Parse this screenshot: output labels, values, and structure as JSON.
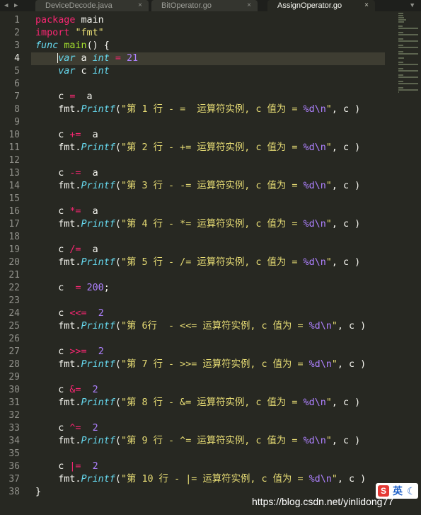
{
  "tabs": [
    {
      "label": "DeviceDecode.java",
      "active": false,
      "close": "×"
    },
    {
      "label": "BitOperator.go",
      "active": false,
      "close": "×"
    },
    {
      "label": "AssignOperator.go",
      "active": true,
      "close": "×"
    }
  ],
  "nav": {
    "left": "◀",
    "right": "▶",
    "overflow": "▼"
  },
  "editor": {
    "current_line": 4,
    "lines": [
      [
        {
          "t": "package",
          "c": "kw"
        },
        {
          "t": " main"
        }
      ],
      [
        {
          "t": "import",
          "c": "kw"
        },
        {
          "t": " "
        },
        {
          "t": "\"fmt\"",
          "c": "st"
        }
      ],
      [
        {
          "t": "func",
          "c": "ty"
        },
        {
          "t": " "
        },
        {
          "t": "main",
          "c": "fn"
        },
        {
          "t": "() {"
        }
      ],
      [
        {
          "t": "    "
        },
        {
          "t": "caret",
          "c": "caret"
        },
        {
          "t": "var",
          "c": "ty"
        },
        {
          "t": " a "
        },
        {
          "t": "int",
          "c": "ty"
        },
        {
          "t": " "
        },
        {
          "t": "=",
          "c": "kw"
        },
        {
          "t": " "
        },
        {
          "t": "21",
          "c": "nu"
        }
      ],
      [
        {
          "t": "    "
        },
        {
          "t": "var",
          "c": "ty"
        },
        {
          "t": " c "
        },
        {
          "t": "int",
          "c": "ty"
        }
      ],
      [],
      [
        {
          "t": "    c "
        },
        {
          "t": "=",
          "c": "kw"
        },
        {
          "t": "  a"
        }
      ],
      [
        {
          "t": "    fmt."
        },
        {
          "t": "Printf",
          "c": "ty"
        },
        {
          "t": "("
        },
        {
          "t": "\"第 1 行 - =  运算符实例, c 值为 = ",
          "c": "st"
        },
        {
          "t": "%d\\n",
          "c": "ph"
        },
        {
          "t": "\"",
          "c": "st"
        },
        {
          "t": ", c )"
        }
      ],
      [],
      [
        {
          "t": "    c "
        },
        {
          "t": "+=",
          "c": "kw"
        },
        {
          "t": "  a"
        }
      ],
      [
        {
          "t": "    fmt."
        },
        {
          "t": "Printf",
          "c": "ty"
        },
        {
          "t": "("
        },
        {
          "t": "\"第 2 行 - += 运算符实例, c 值为 = ",
          "c": "st"
        },
        {
          "t": "%d\\n",
          "c": "ph"
        },
        {
          "t": "\"",
          "c": "st"
        },
        {
          "t": ", c )"
        }
      ],
      [],
      [
        {
          "t": "    c "
        },
        {
          "t": "-=",
          "c": "kw"
        },
        {
          "t": "  a"
        }
      ],
      [
        {
          "t": "    fmt."
        },
        {
          "t": "Printf",
          "c": "ty"
        },
        {
          "t": "("
        },
        {
          "t": "\"第 3 行 - -= 运算符实例, c 值为 = ",
          "c": "st"
        },
        {
          "t": "%d\\n",
          "c": "ph"
        },
        {
          "t": "\"",
          "c": "st"
        },
        {
          "t": ", c )"
        }
      ],
      [],
      [
        {
          "t": "    c "
        },
        {
          "t": "*=",
          "c": "kw"
        },
        {
          "t": "  a"
        }
      ],
      [
        {
          "t": "    fmt."
        },
        {
          "t": "Printf",
          "c": "ty"
        },
        {
          "t": "("
        },
        {
          "t": "\"第 4 行 - *= 运算符实例, c 值为 = ",
          "c": "st"
        },
        {
          "t": "%d\\n",
          "c": "ph"
        },
        {
          "t": "\"",
          "c": "st"
        },
        {
          "t": ", c )"
        }
      ],
      [],
      [
        {
          "t": "    c "
        },
        {
          "t": "/=",
          "c": "kw"
        },
        {
          "t": "  a"
        }
      ],
      [
        {
          "t": "    fmt."
        },
        {
          "t": "Printf",
          "c": "ty"
        },
        {
          "t": "("
        },
        {
          "t": "\"第 5 行 - /= 运算符实例, c 值为 = ",
          "c": "st"
        },
        {
          "t": "%d\\n",
          "c": "ph"
        },
        {
          "t": "\"",
          "c": "st"
        },
        {
          "t": ", c )"
        }
      ],
      [],
      [
        {
          "t": "    c  "
        },
        {
          "t": "=",
          "c": "kw"
        },
        {
          "t": " "
        },
        {
          "t": "200",
          "c": "nu"
        },
        {
          "t": ";"
        }
      ],
      [],
      [
        {
          "t": "    c "
        },
        {
          "t": "<<=",
          "c": "kw"
        },
        {
          "t": "  "
        },
        {
          "t": "2",
          "c": "nu"
        }
      ],
      [
        {
          "t": "    fmt."
        },
        {
          "t": "Printf",
          "c": "ty"
        },
        {
          "t": "("
        },
        {
          "t": "\"第 6行  - <<= 运算符实例, c 值为 = ",
          "c": "st"
        },
        {
          "t": "%d\\n",
          "c": "ph"
        },
        {
          "t": "\"",
          "c": "st"
        },
        {
          "t": ", c )"
        }
      ],
      [],
      [
        {
          "t": "    c "
        },
        {
          "t": ">>=",
          "c": "kw"
        },
        {
          "t": "  "
        },
        {
          "t": "2",
          "c": "nu"
        }
      ],
      [
        {
          "t": "    fmt."
        },
        {
          "t": "Printf",
          "c": "ty"
        },
        {
          "t": "("
        },
        {
          "t": "\"第 7 行 - >>= 运算符实例, c 值为 = ",
          "c": "st"
        },
        {
          "t": "%d\\n",
          "c": "ph"
        },
        {
          "t": "\"",
          "c": "st"
        },
        {
          "t": ", c )"
        }
      ],
      [],
      [
        {
          "t": "    c "
        },
        {
          "t": "&=",
          "c": "kw"
        },
        {
          "t": "  "
        },
        {
          "t": "2",
          "c": "nu"
        }
      ],
      [
        {
          "t": "    fmt."
        },
        {
          "t": "Printf",
          "c": "ty"
        },
        {
          "t": "("
        },
        {
          "t": "\"第 8 行 - &= 运算符实例, c 值为 = ",
          "c": "st"
        },
        {
          "t": "%d\\n",
          "c": "ph"
        },
        {
          "t": "\"",
          "c": "st"
        },
        {
          "t": ", c )"
        }
      ],
      [],
      [
        {
          "t": "    c "
        },
        {
          "t": "^=",
          "c": "kw"
        },
        {
          "t": "  "
        },
        {
          "t": "2",
          "c": "nu"
        }
      ],
      [
        {
          "t": "    fmt."
        },
        {
          "t": "Printf",
          "c": "ty"
        },
        {
          "t": "("
        },
        {
          "t": "\"第 9 行 - ^= 运算符实例, c 值为 = ",
          "c": "st"
        },
        {
          "t": "%d\\n",
          "c": "ph"
        },
        {
          "t": "\"",
          "c": "st"
        },
        {
          "t": ", c )"
        }
      ],
      [],
      [
        {
          "t": "    c "
        },
        {
          "t": "|=",
          "c": "kw"
        },
        {
          "t": "  "
        },
        {
          "t": "2",
          "c": "nu"
        }
      ],
      [
        {
          "t": "    fmt."
        },
        {
          "t": "Printf",
          "c": "ty"
        },
        {
          "t": "("
        },
        {
          "t": "\"第 10 行 - |= 运算符实例, c 值为 = ",
          "c": "st"
        },
        {
          "t": "%d\\n",
          "c": "ph"
        },
        {
          "t": "\"",
          "c": "st"
        },
        {
          "t": ", c )"
        }
      ],
      [
        {
          "t": "}"
        }
      ]
    ]
  },
  "watermark": "https://blog.csdn.net/yinlidong77",
  "ime": {
    "logo": "S",
    "label": "英",
    "mode_icon": "☾"
  },
  "colors": {
    "background": "#272822",
    "keyword": "#f92672",
    "string": "#e6db74",
    "function": "#a6e22e",
    "type": "#66d9ef",
    "number": "#ae81ff"
  }
}
